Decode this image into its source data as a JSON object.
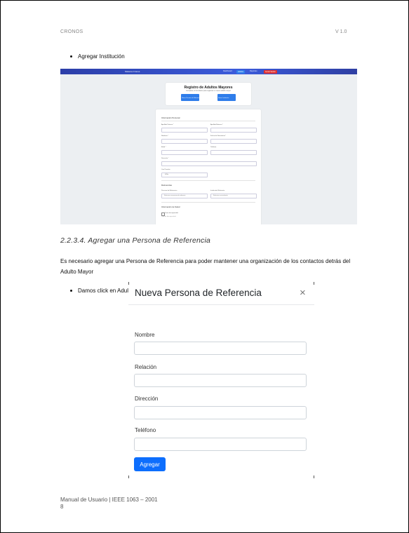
{
  "header": {
    "left": "CRONOS",
    "right": "V 1.0"
  },
  "bullets": {
    "first": "Agregar Institución",
    "second": "Damos click en Adulto Mayor"
  },
  "screenshot1": {
    "brand": "Sistema Cronos",
    "nav_links": [
      "Dashboard",
      "Adultos",
      "Reportes"
    ],
    "nav_button": "Cerrar Sesión",
    "accent": "#2f7dea",
    "danger": "#e03131",
    "card_title": "Registro de Adultos Mayores",
    "card_subtitle": "Complete el formulario para registrar un nuevo adulto mayor",
    "card_buttons": [
      "Nueva Persona de Referencia",
      "Nueva Institución"
    ],
    "sections": [
      "Información Personal",
      "Referencias",
      "Información de Salud"
    ],
    "fields": [
      "Apellido Paterno *",
      "Apellido Materno *",
      "Nombres *",
      "Fecha de Nacimiento *",
      "Edad *",
      "Teléfono",
      "Dirección *",
      "Con Pensión"
    ],
    "select_value": "Sí/No",
    "reference_fields": [
      "Persona de Referencia",
      "Institución Referente"
    ],
    "reference_placeholders": [
      "Seleccione una persona de referencia",
      "Seleccione una institución"
    ],
    "checkbox_label": "Tiene discapacidad",
    "help_text": "Tipo de discapacidad"
  },
  "section_heading": "2.2.3.4. Agregar una Persona de Referencia",
  "paragraph": "Es necesario agregar una Persona de Referencia para poder mantener una organización de los contactos detrás del Adulto Mayor",
  "modal": {
    "title": "Nueva Persona de Referencia",
    "close_icon": "×",
    "fields": [
      {
        "label": "Nombre",
        "value": ""
      },
      {
        "label": "Relación",
        "value": ""
      },
      {
        "label": "Dirección",
        "value": ""
      },
      {
        "label": "Teléfono",
        "value": ""
      }
    ],
    "submit_label": "Agregar",
    "submit_color": "#0d6efd"
  },
  "footer": {
    "line1": "Manual de Usuario | IEEE 1063 – 2001",
    "page": "8"
  }
}
